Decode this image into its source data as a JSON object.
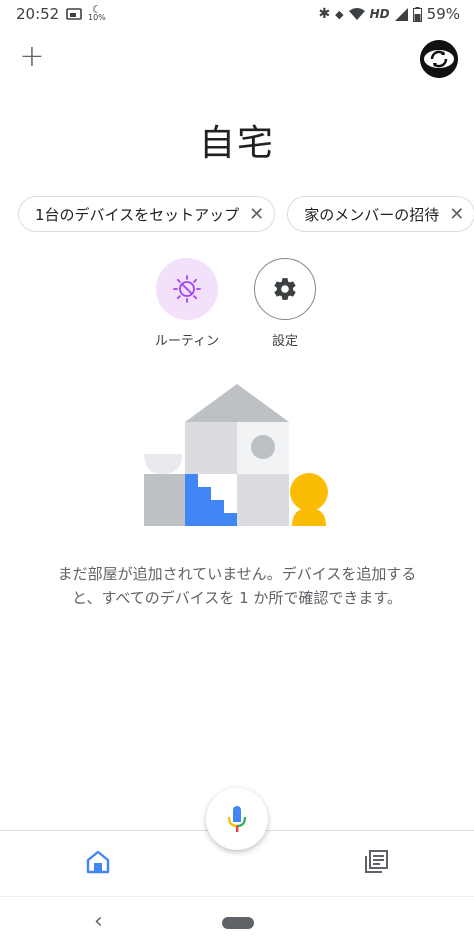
{
  "status_bar": {
    "time": "20:52",
    "data_saver_label": "10%",
    "network": "HD",
    "battery_percent": "59%"
  },
  "header": {
    "home_name": "自宅"
  },
  "chips": [
    {
      "label": "1台のデバイスをセットアップ"
    },
    {
      "label": "家のメンバーの招待"
    }
  ],
  "actions": {
    "routine_label": "ルーティン",
    "settings_label": "設定"
  },
  "empty_state": {
    "line1": "まだ部屋が追加されていません。デバイスを追加する",
    "line2": "と、すべてのデバイスを 1 か所で確認できます。"
  },
  "colors": {
    "accent_blue": "#4285f4",
    "routine_bg": "#f3e0fa",
    "routine_icon": "#a142f4",
    "mic_red": "#ea4335",
    "mic_blue": "#4285f4",
    "mic_yellow": "#fbbc04",
    "mic_green": "#34a853"
  }
}
